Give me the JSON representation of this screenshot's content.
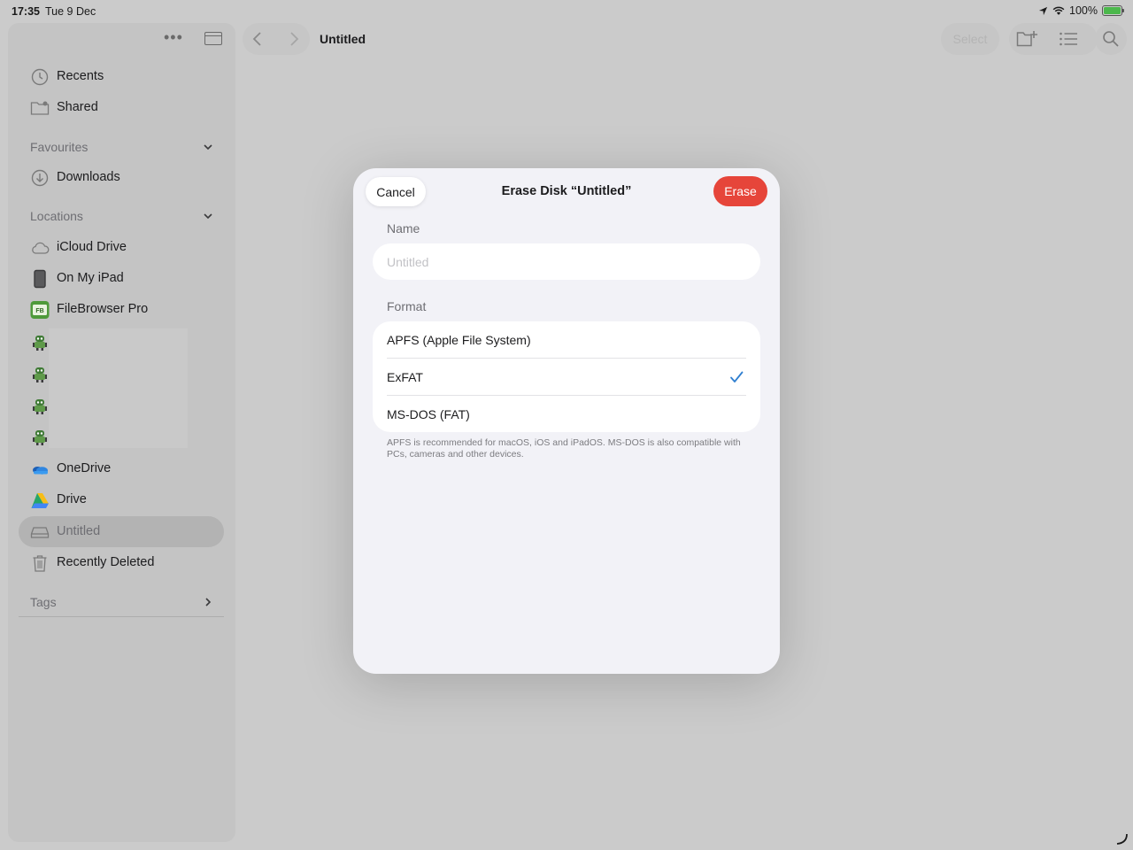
{
  "status_bar": {
    "time": "17:35",
    "date": "Tue 9 Dec",
    "battery": "100%"
  },
  "sidebar": {
    "more_label": "•••",
    "top_items": [
      {
        "label": "Recents",
        "icon": "clock-icon"
      },
      {
        "label": "Shared",
        "icon": "shared-folder-icon"
      }
    ],
    "favourites": {
      "header": "Favourites",
      "items": [
        {
          "label": "Downloads",
          "icon": "download-icon"
        }
      ]
    },
    "locations": {
      "header": "Locations",
      "items": [
        {
          "label": "iCloud Drive",
          "icon": "cloud-icon"
        },
        {
          "label": "On My iPad",
          "icon": "ipad-icon"
        },
        {
          "label": "FileBrowser Pro",
          "icon": "filebrowser-icon"
        },
        {
          "label": "",
          "icon": "robot-icon"
        },
        {
          "label": "",
          "icon": "robot-icon"
        },
        {
          "label": "",
          "icon": "robot-icon"
        },
        {
          "label": "",
          "icon": "robot-icon"
        },
        {
          "label": "OneDrive",
          "icon": "onedrive-icon"
        },
        {
          "label": "Drive",
          "icon": "google-drive-icon"
        },
        {
          "label": "Untitled",
          "icon": "external-disk-icon",
          "selected": true
        },
        {
          "label": "Recently Deleted",
          "icon": "trash-icon"
        }
      ]
    },
    "tags": {
      "header": "Tags"
    }
  },
  "toolbar": {
    "title": "Untitled",
    "select_label": "Select"
  },
  "dialog": {
    "cancel_label": "Cancel",
    "title": "Erase Disk “Untitled”",
    "erase_label": "Erase",
    "name_section": "Name",
    "name_placeholder": "Untitled",
    "name_value": "",
    "format_section": "Format",
    "formats": [
      {
        "label": "APFS (Apple File System)",
        "selected": false
      },
      {
        "label": "ExFAT",
        "selected": true
      },
      {
        "label": "MS-DOS (FAT)",
        "selected": false
      }
    ],
    "footnote": "APFS is recommended for macOS, iOS and iPadOS. MS-DOS is also compatible with PCs, cameras and other devices."
  },
  "colors": {
    "accent": "#2f7fd0",
    "destructive": "#e6453a",
    "dialog_background": "#f2f2f7"
  }
}
